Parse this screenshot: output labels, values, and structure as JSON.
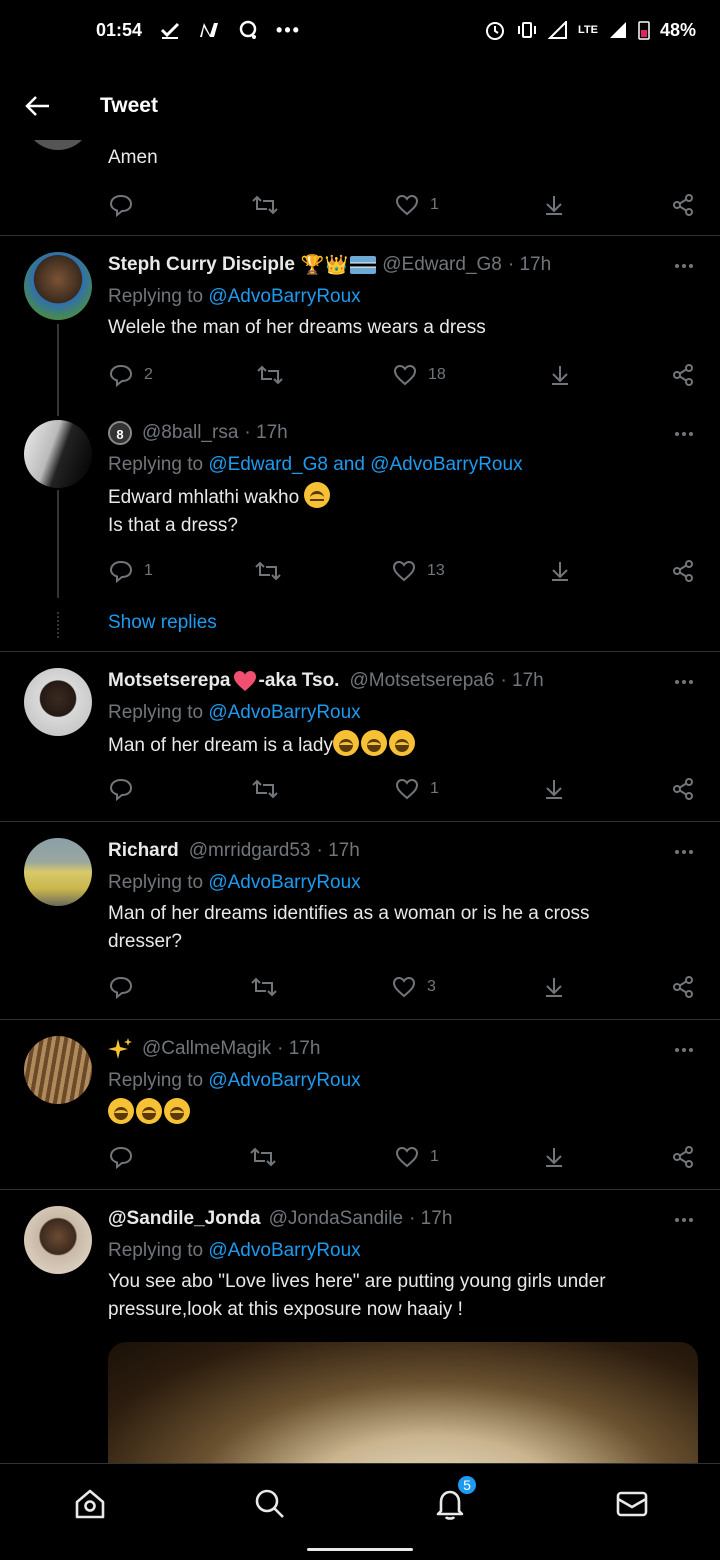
{
  "status": {
    "time": "01:54",
    "network": "LTE",
    "battery": "48%"
  },
  "header": {
    "title": "Tweet"
  },
  "tweets": [
    {
      "text": "Amen",
      "likes": "1"
    },
    {
      "name": "Steph Curry Disciple",
      "handle": "@Edward_G8",
      "time": "· 17h",
      "reply_prefix": "Replying to",
      "reply_to": "@AdvoBarryRoux",
      "text": "Welele the man of her dreams wears a dress",
      "replies": "2",
      "likes": "18"
    },
    {
      "name": "",
      "handle": "@8ball_rsa",
      "time": "· 17h",
      "reply_prefix": "Replying to",
      "reply_to": "@Edward_G8 and @AdvoBarryRoux",
      "text_line1": "Edward mhlathi wakho",
      "text_line2": "Is that a dress?",
      "replies": "1",
      "likes": "13",
      "show_replies": "Show replies"
    },
    {
      "name": "Motsetserepa",
      "name_suffix": "-aka Tso.",
      "handle": "@Motsetserepa6",
      "time": "· 17h",
      "reply_prefix": "Replying to",
      "reply_to": "@AdvoBarryRoux",
      "text": "Man of her dream is a lady",
      "likes": "1"
    },
    {
      "name": "Richard",
      "handle": "@mrridgard53",
      "time": "· 17h",
      "reply_prefix": "Replying to",
      "reply_to": "@AdvoBarryRoux",
      "text": "Man of her dreams identifies as a woman or is he a cross dresser?",
      "likes": "3"
    },
    {
      "name": "",
      "handle": "@CallmeMagik",
      "time": "· 17h",
      "reply_prefix": "Replying to",
      "reply_to": "@AdvoBarryRoux",
      "likes": "1"
    },
    {
      "name": "@Sandile_Jonda",
      "handle": "@JondaSandile",
      "time": "· 17h",
      "reply_prefix": "Replying to",
      "reply_to": "@AdvoBarryRoux",
      "text": "You see abo \"Love lives here\" are putting young girls under pressure,look at this exposure now haaiy !"
    }
  ],
  "nav": {
    "notifications_badge": "5"
  },
  "colors": {
    "background": "#000000",
    "accent": "#1d9bf0",
    "muted": "#71767b",
    "text": "#e7e9ea",
    "divider": "#2f3336"
  }
}
